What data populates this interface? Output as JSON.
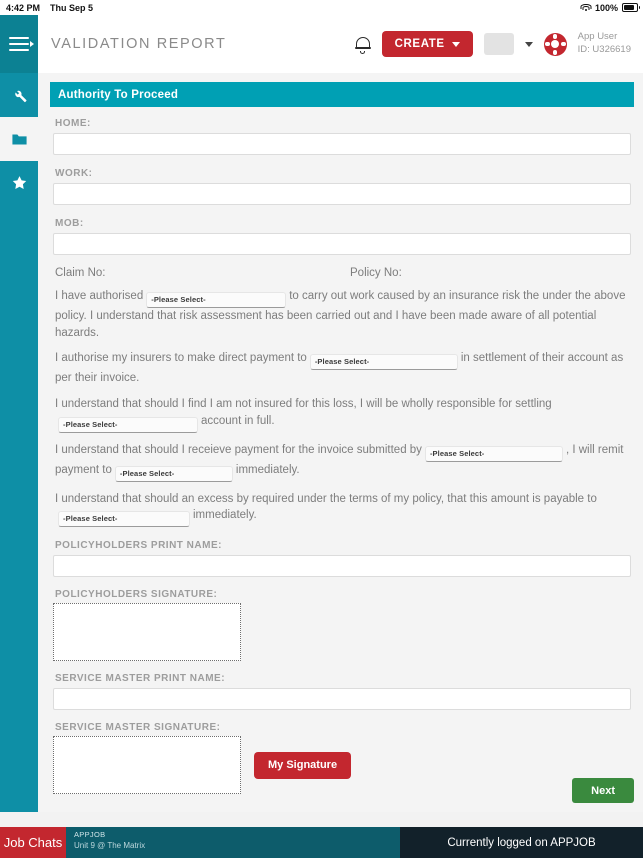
{
  "statusbar": {
    "time": "4:42 PM",
    "date": "Thu Sep 5",
    "battery_percent": "100%",
    "wifi_icon": "wifi-icon",
    "battery_icon": "battery-icon"
  },
  "header": {
    "menu_icon": "hamburger-menu-icon",
    "title": "VALIDATION REPORT",
    "notifications_icon": "bell-icon",
    "create_label": "CREATE",
    "user_name": "App User",
    "user_id": "ID: U326619",
    "avatar_icon": "lifebuoy-avatar-icon"
  },
  "sidebar": {
    "items": [
      {
        "name": "sidebar-item-tools",
        "icon": "wrench-icon",
        "selected": false
      },
      {
        "name": "sidebar-item-files",
        "icon": "folder-icon",
        "selected": true
      },
      {
        "name": "sidebar-item-favourites",
        "icon": "star-icon",
        "selected": false
      }
    ]
  },
  "panel": {
    "title": "Authority To Proceed",
    "accent_color": "#00a0b4",
    "fields": [
      {
        "label": "HOME:",
        "value": "",
        "placeholder": ""
      },
      {
        "label": "WORK:",
        "value": "",
        "placeholder": ""
      },
      {
        "label": "MOB:",
        "value": "",
        "placeholder": ""
      }
    ],
    "claim_no_label": "Claim No:",
    "policy_no_label": "Policy No:",
    "select_placeholder": "-Please Select-",
    "paragraphs": {
      "p1_a": "I have authorised",
      "p1_b": "to carry out work caused by an insurance risk the under the above policy. I understand that risk assessment has been carried out and I have been made aware of all potential hazards.",
      "p2_a": "I authorise my insurers to make direct payment to",
      "p2_b": "in settlement of their account as per their invoice.",
      "p3_a": "I understand that should I find I am not insured for this loss, I will be wholly responsible for settling",
      "p3_b": "account in full.",
      "p4_a": "I understand that should I receieve payment for the invoice submitted by",
      "p4_b": ", I will remit payment to",
      "p4_c": "immediately.",
      "p5_a": "I understand that should an excess by required under the terms of my policy, that this amount is payable to",
      "p5_b": "immediately."
    },
    "policyholder_print_label": "POLICYHOLDERS PRINT NAME:",
    "policyholder_print_value": "",
    "policyholder_signature_label": "POLICYHOLDERS SIGNATURE:",
    "service_master_print_label": "SERVICE MASTER PRINT NAME:",
    "service_master_print_value": "",
    "service_master_signature_label": "SERVICE MASTER SIGNATURE:",
    "my_signature_label": "My Signature",
    "signature_button_color": "#c3272f"
  },
  "actions": {
    "next_label": "Next",
    "next_color": "#3a8a3e"
  },
  "footer": {
    "job_chats_label": "Job Chats",
    "job_code": "APPJOB",
    "job_location": "Unit 9 @ The Matrix",
    "logged_on_text": "Currently logged on APPJOB"
  }
}
